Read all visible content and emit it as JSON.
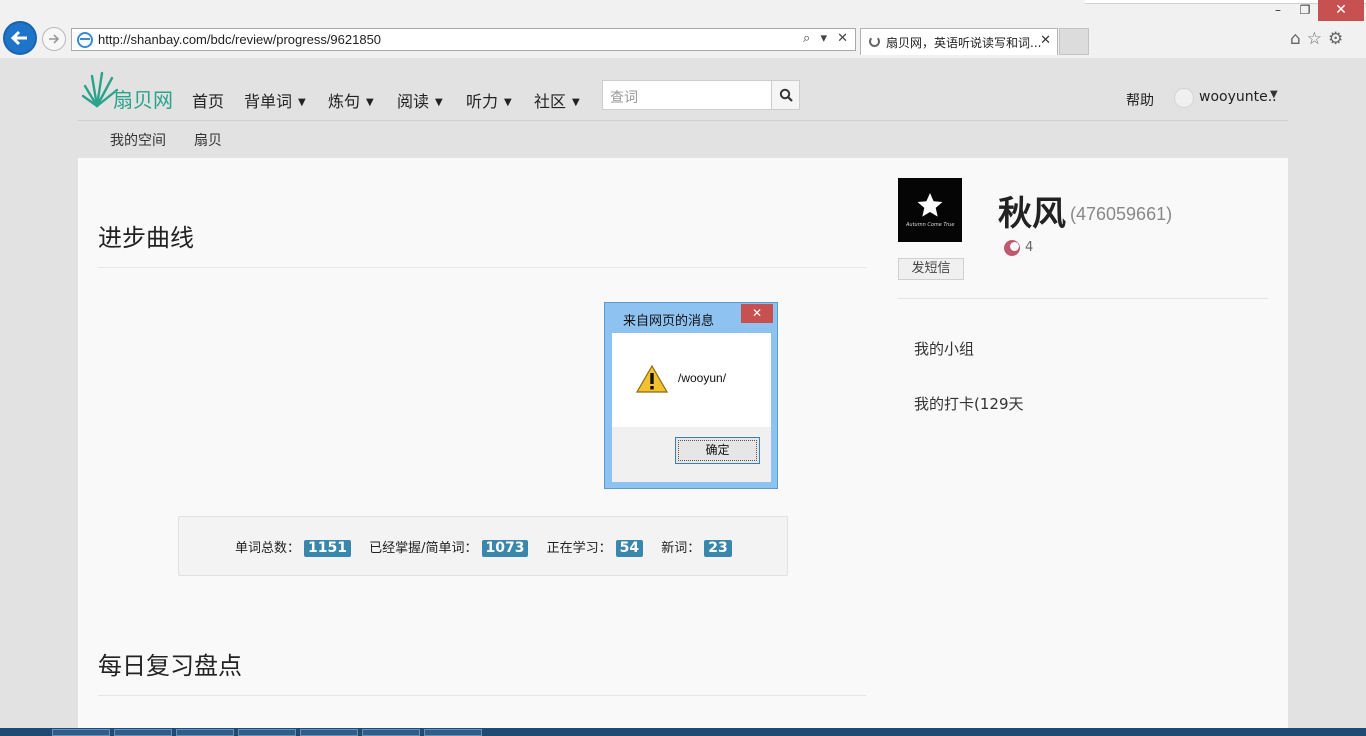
{
  "browser": {
    "url": "http://shanbay.com/bdc/review/progress/9621850",
    "tab_title": "扇贝网，英语听说读写和词...",
    "tab_close": "✕",
    "addr_tools": "⌕ ▾ ✕",
    "win_minimize": "–",
    "win_maximize": "❐",
    "win_close": "✕",
    "toolbar_icons": "⌂☆⚙"
  },
  "site": {
    "logo": "扇贝网",
    "nav": {
      "home": "首页",
      "words": "背单词",
      "sentences": "炼句",
      "reading": "阅读",
      "listening": "听力",
      "community": "社区"
    },
    "search_placeholder": "查词",
    "help": "帮助",
    "user": "wooyunte..",
    "subnav": {
      "my_space": "我的空间",
      "shanbay": "扇贝"
    }
  },
  "main": {
    "progress_title": "进步曲线",
    "stats": {
      "total_label": "单词总数：",
      "total": "1151",
      "mastered_label": "已经掌握/简单词：",
      "mastered": "1073",
      "learning_label": "正在学习：",
      "learning": "54",
      "new_label": "新词：",
      "new": "23"
    },
    "daily_title": "每日复习盘点"
  },
  "profile": {
    "name": "秋风",
    "id": "(476059661)",
    "level": "4",
    "message_button": "发短信",
    "links": {
      "groups": "我的小组",
      "checkin": "我的打卡(129天"
    },
    "avatar_tag": "Autumn Come True"
  },
  "dialog": {
    "title": "来自网页的消息",
    "message": "/wooyun/",
    "ok": "确定",
    "close": "✕"
  },
  "colors": {
    "accent": "#2aa38b",
    "badge": "#3a87ad",
    "dialog_frame": "#8ec2f0",
    "close_red": "#c75050"
  }
}
